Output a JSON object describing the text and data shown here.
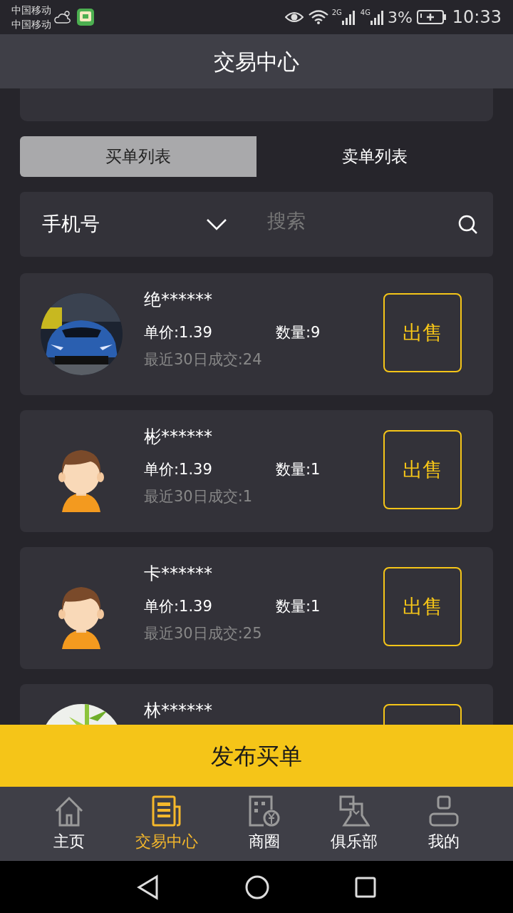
{
  "status_bar": {
    "carriers": [
      "中国移动",
      "中国移动"
    ],
    "network_2g": "2G",
    "network_4g": "4G",
    "battery": "3%",
    "time": "10:33"
  },
  "header": {
    "title": "交易中心"
  },
  "tabs": [
    {
      "label": "买单列表",
      "selected": true
    },
    {
      "label": "卖单列表",
      "selected": false
    }
  ],
  "search": {
    "filter": "手机号",
    "placeholder": "搜索"
  },
  "orders": [
    {
      "kind": "car",
      "name": "绝******",
      "price": "单价:1.39",
      "quantity": "数量:9",
      "recent": "最近30日成交:24",
      "action": "出售"
    },
    {
      "kind": "cartoon",
      "name": "彬******",
      "price": "单价:1.39",
      "quantity": "数量:1",
      "recent": "最近30日成交:1",
      "action": "出售"
    },
    {
      "kind": "cartoon",
      "name": "卡******",
      "price": "单价:1.39",
      "quantity": "数量:1",
      "recent": "最近30日成交:25",
      "action": "出售"
    },
    {
      "kind": "bamboo",
      "name": "林******"
    }
  ],
  "publish_button": "发布买单",
  "nav": [
    {
      "kind": "home",
      "label": "主页",
      "selected": false
    },
    {
      "kind": "document",
      "label": "交易中心",
      "selected": true
    },
    {
      "kind": "shop",
      "label": "商圈",
      "selected": false
    },
    {
      "kind": "club",
      "label": "俱乐部",
      "selected": false
    },
    {
      "kind": "user",
      "label": "我的",
      "selected": false
    }
  ]
}
